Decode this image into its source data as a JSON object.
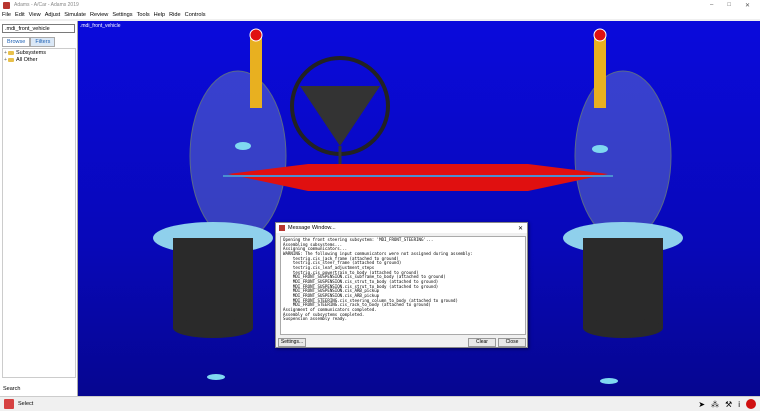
{
  "window": {
    "title": "Adams - A/Car - Adams 2019"
  },
  "menu": [
    "File",
    "Edit",
    "View",
    "Adjust",
    "Simulate",
    "Review",
    "Settings",
    "Tools",
    "Help",
    "Ride",
    "Controls"
  ],
  "sidebar": {
    "model_name": ".mdi_front_vehicle",
    "tabs": [
      "Browse",
      "Filters"
    ],
    "tree": [
      "Subsystems",
      "All Other"
    ],
    "search_label": "Search"
  },
  "viewport": {
    "label": ".mdi_front_vehicle"
  },
  "message_window": {
    "title": "Message Window...",
    "lines": [
      "Opening the front steering subsystem: 'MDI_FRONT_STEERING'...",
      "Assembling subsystems...",
      "Assigning communicators...",
      "WARNING: The following input communicators were not assigned during assembly:",
      "    testrig.cis_jack_frame (attached to ground)",
      "    testrig.cis_steer_frame (attached to ground)",
      "    testrig.cis_leaf_adjustment_steps",
      "    testrig.cis_powertrain_to_body (attached to ground)",
      "    MDI_FRONT_SUSPENSION.cis_subframe_to_body (attached to ground)",
      "    MDI_FRONT_SUSPENSION.cis_strut_to_body (attached to ground)",
      "    MDI_FRONT_SUSPENSION.cis_strut_to_body (attached to ground)",
      "    MDI_FRONT_SUSPENSION.cis_ARB_pickup",
      "    MDI_FRONT_SUSPENSION.cis_ARB_pickup",
      "    MDI_FRONT_STEERING.cis_steering_column_to_body (attached to ground)",
      "    MDI_FRONT_STEERING.cis_rack_to_body (attached to ground)",
      "Assignment of communicators completed.",
      "Assembly of subsystems completed.",
      "Suspension assembly ready."
    ],
    "settings_label": "Settings...",
    "clear_label": "Clear",
    "close_label": "Close"
  },
  "statusbar": {
    "text": "Select"
  },
  "colors": {
    "viewport_bg": "#0a0adc",
    "rack": "#e01010",
    "spring": "#e8b020",
    "wheel": "#8fb8d8",
    "hub": "#7fd8f0"
  }
}
